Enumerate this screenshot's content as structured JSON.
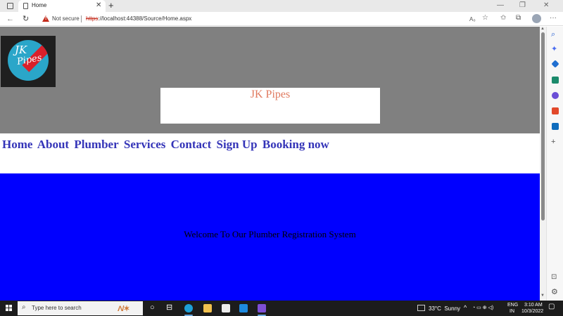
{
  "browser": {
    "tab_title": "Home",
    "tab_close": "✕",
    "new_tab": "+",
    "security_label": "Not secure",
    "url_scheme": "https",
    "url_rest": "://localhost:44388/Source/Home.aspx",
    "window_controls": [
      "—",
      "❐",
      "✕"
    ],
    "toolbar_icons": [
      "read-aloud-icon",
      "add-favorite-icon",
      "favorites-icon",
      "collections-icon",
      "profile-icon",
      "more-icon"
    ]
  },
  "page": {
    "logo_text_line1": "JK",
    "logo_text_line2": "Pipes",
    "site_title": "JK Pipes",
    "nav_items": [
      "Home",
      "About",
      "Plumber",
      "Services",
      "Contact",
      "Sign Up",
      "Booking now"
    ],
    "welcome_text": "Welcome To Our Plumber Registration System",
    "colors": {
      "header_band": "#808080",
      "title_text": "#e07a5f",
      "nav_text": "#3434b8",
      "welcome_band": "#0000ff"
    }
  },
  "edge_sidebar": {
    "icons": [
      "search-icon",
      "discover-icon",
      "shopping-tag-icon",
      "tools-icon",
      "games-icon",
      "office-icon",
      "outlook-icon",
      "add-icon",
      "sidebar-toggle-icon",
      "settings-icon"
    ]
  },
  "taskbar": {
    "search_placeholder": "Type here to search",
    "temperature": "33°C",
    "condition": "Sunny",
    "language_line1": "ENG",
    "language_line2": "IN",
    "time": "3:10 AM",
    "date": "10/3/2022"
  }
}
